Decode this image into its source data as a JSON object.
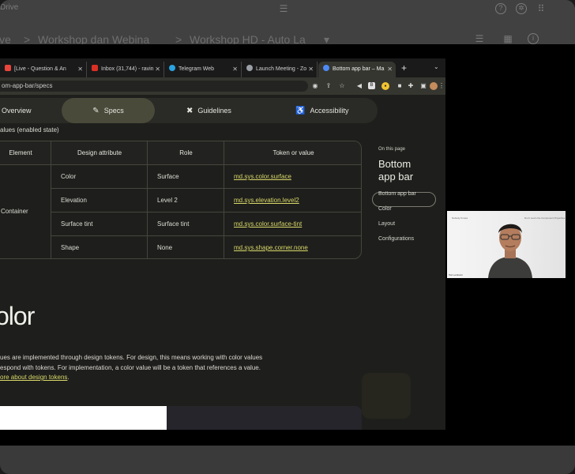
{
  "drive": {
    "app_title": "Drive",
    "crumbs": [
      "ive",
      ">",
      "Workshop dan Webina",
      ">",
      "Workshop HD - Auto La",
      "▾"
    ]
  },
  "browser": {
    "tabs": [
      {
        "label": "[Live - Question & An",
        "fav_color": "#e8453c"
      },
      {
        "label": "Inbox (31,744) - ravin",
        "fav_color": "#d93025"
      },
      {
        "label": "Telegram Web",
        "fav_color": "#2aa3e0"
      },
      {
        "label": "Launch Meeting - Zo",
        "fav_color": "#9aa0a6"
      },
      {
        "label": "Bottom app bar – Ma",
        "fav_color": "#4e8af4"
      }
    ],
    "url": "om-app-bar/specs"
  },
  "nav": {
    "items": [
      {
        "label": "Overview",
        "icon": ""
      },
      {
        "label": "Specs",
        "icon": "specs-icon"
      },
      {
        "label": "Guidelines",
        "icon": "guidelines-icon"
      },
      {
        "label": "Accessibility",
        "icon": "accessibility-icon"
      }
    ]
  },
  "caption": "alues (enabled state)",
  "table": {
    "headers": [
      "Element",
      "Design attribute",
      "Role",
      "Token or value"
    ],
    "element": "Container",
    "rows": [
      {
        "attribute": "Color",
        "role": "Surface",
        "token": "md.sys.color.surface"
      },
      {
        "attribute": "Elevation",
        "role": "Level 2",
        "token": "md.sys.elevation.level2"
      },
      {
        "attribute": "Surface tint",
        "role": "Surface tint",
        "token": "md.sys.color.surface-tint"
      },
      {
        "attribute": "Shape",
        "role": "None",
        "token": "md.sys.shape.corner.none"
      }
    ]
  },
  "toc": {
    "heading": "On this page",
    "title_line1": "Bottom",
    "title_line2": "app bar",
    "items": [
      "Bottom app bar",
      "Color",
      "Layout",
      "Configurations"
    ]
  },
  "section": {
    "title": "olor",
    "line1": "ues are implemented through design tokens. For design, this means working with color values",
    "line2": "espond with tokens. For implementation, a color value will be a token that references a value.",
    "link": "ore about design tokens",
    "link_end": "."
  },
  "video": {
    "header_left": "Nobody Knows",
    "header_right": "Don't Learn the Component Properties",
    "name": "Tok Lamborin"
  }
}
